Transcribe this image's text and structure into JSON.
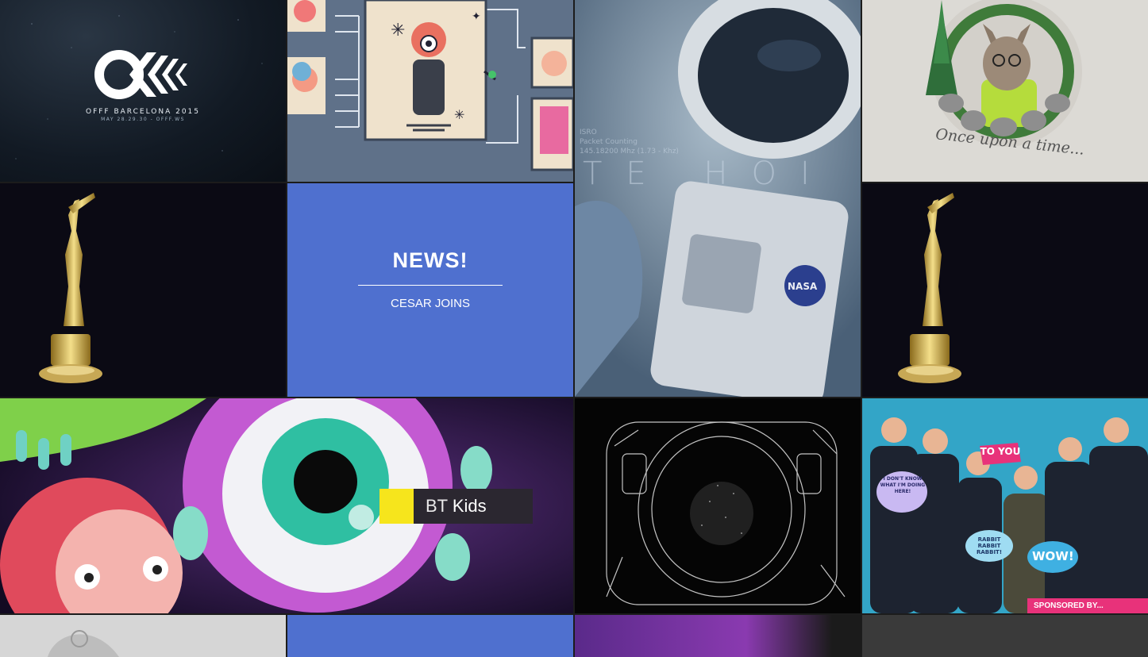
{
  "grid": {
    "tiles": [
      {
        "id": "offf",
        "brand": "OFFF",
        "subtitle": "OFFF BARCELONA 2015",
        "detail": "MAY 28.29.30 - OFFF.WS"
      },
      {
        "id": "illustration"
      },
      {
        "id": "astronaut",
        "overlay_line1": "ISRO",
        "overlay_line2": "Packet Counting",
        "overlay_line3": "145.18200 Mhz (1.73 - Khz)",
        "overlay_big": "TE  HOI",
        "badge": "NASA"
      },
      {
        "id": "wolf",
        "caption": "Once upon a time..."
      },
      {
        "id": "award-left"
      },
      {
        "id": "news",
        "title": "NEWS!",
        "subtitle": "CESAR JOINS"
      },
      {
        "id": "award-right"
      },
      {
        "id": "bt-kids",
        "label_thin": "BT",
        "label_bold": "Kids"
      },
      {
        "id": "astronaut-sketch"
      },
      {
        "id": "party",
        "sign1": "TO YOU",
        "sign2": "I DON'T KNOW WHAT I'M DOING HERE!",
        "sign3": "RABBIT RABBIT RABBIT!",
        "sign4": "WOW!",
        "sponsor": "SPONSORED BY..."
      }
    ]
  },
  "colors": {
    "news_bg": "#4f70cf",
    "bt_yellow": "#f6e51c",
    "party_bg": "#2fa3c6"
  }
}
